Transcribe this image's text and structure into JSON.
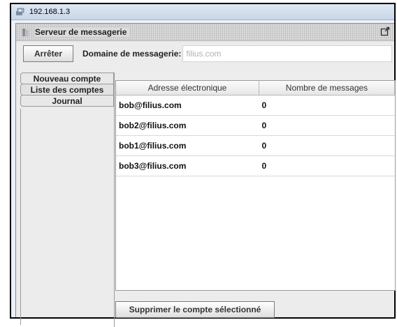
{
  "window": {
    "title": "192.168.1.3"
  },
  "app": {
    "title": "Serveur de messagerie"
  },
  "toolbar": {
    "stop_label": "Arrêter",
    "domain_label": "Domaine de messagerie:",
    "domain_value": "filius.com"
  },
  "tabs": [
    {
      "label": "Nouveau compte",
      "active": false
    },
    {
      "label": "Liste des comptes",
      "active": true
    },
    {
      "label": "Journal",
      "active": false
    }
  ],
  "table": {
    "columns": [
      "Adresse électronique",
      "Nombre de messages"
    ],
    "rows": [
      {
        "address": "bob@filius.com",
        "count": "0"
      },
      {
        "address": "bob2@filius.com",
        "count": "0"
      },
      {
        "address": "bob1@filius.com",
        "count": "0"
      },
      {
        "address": "bob3@filius.com",
        "count": "0"
      }
    ]
  },
  "actions": {
    "delete_label": "Supprimer le compte sélectionné"
  },
  "icons": {
    "window": "network-node-icon",
    "app": "server-icon",
    "maximize": "maximize-icon"
  }
}
